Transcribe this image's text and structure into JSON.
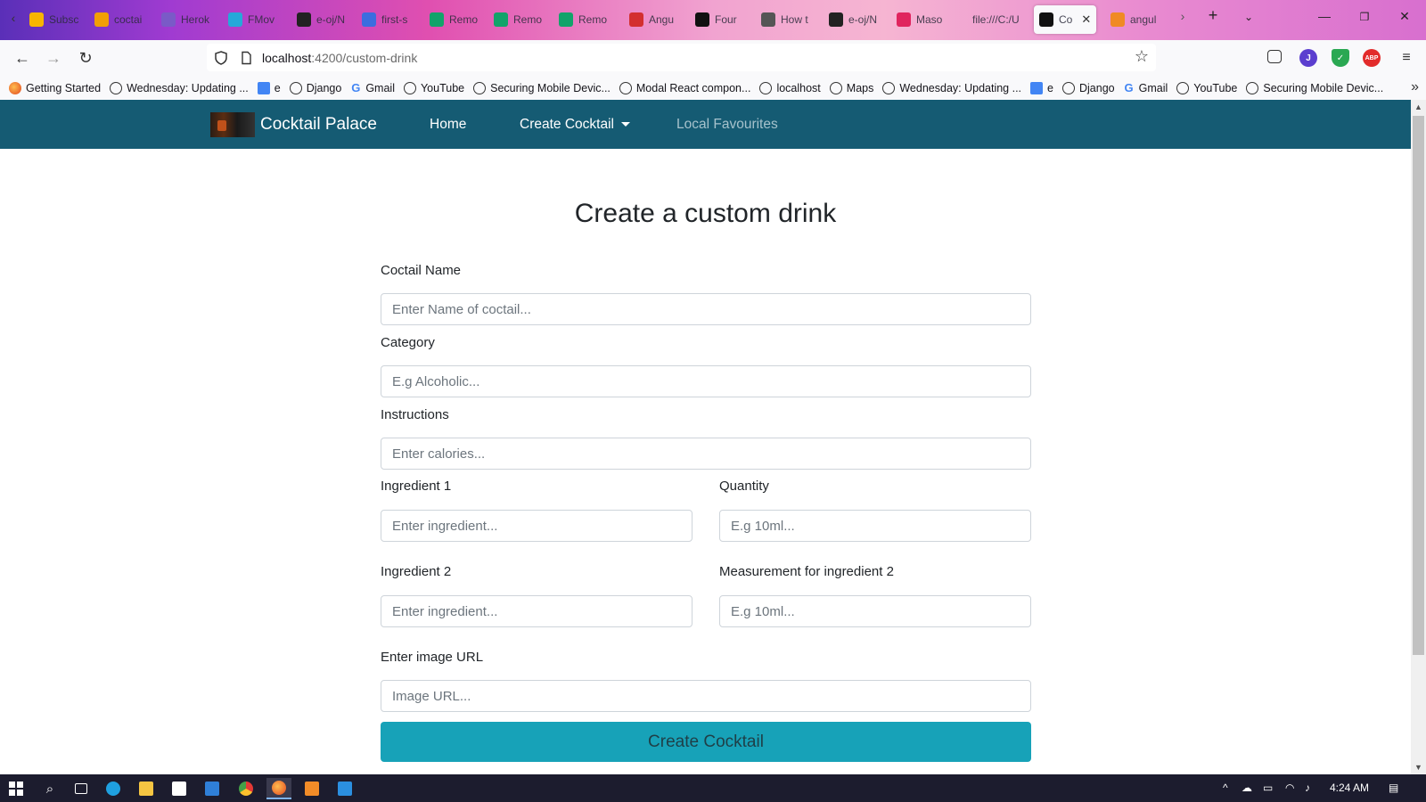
{
  "browser": {
    "tabs": [
      {
        "label": "Subsc",
        "color": "#f7b500"
      },
      {
        "label": "coctai",
        "color": "#f29f05"
      },
      {
        "label": "Herok",
        "color": "#7a5ac7"
      },
      {
        "label": "FMov",
        "color": "#25a9d9"
      },
      {
        "label": "e-oj/N",
        "color": "#222222"
      },
      {
        "label": "first-s",
        "color": "#3c6ddf"
      },
      {
        "label": "Remo",
        "color": "#12a36a"
      },
      {
        "label": "Remo",
        "color": "#12a36a"
      },
      {
        "label": "Remo",
        "color": "#12a36a"
      },
      {
        "label": "Angu",
        "color": "#d32f2f"
      },
      {
        "label": "Four",
        "color": "#111111"
      },
      {
        "label": "How t",
        "color": "#555555"
      },
      {
        "label": "e-oj/N",
        "color": "#222222"
      },
      {
        "label": "Maso",
        "color": "#e0245e"
      },
      {
        "label": "file:///C:/U",
        "color": ""
      },
      {
        "label": "Co",
        "color": "#111111"
      },
      {
        "label": "angul",
        "color": "#f08a24"
      }
    ],
    "url_host": "localhost",
    "url_path": ":4200/custom-drink",
    "bookmarks": [
      "Getting Started",
      "Wednesday: Updating ...",
      "e",
      "Django",
      "Gmail",
      "YouTube",
      "Securing Mobile Devic...",
      "Modal React compon...",
      "localhost",
      "Maps",
      "Wednesday: Updating ...",
      "e",
      "Django",
      "Gmail",
      "YouTube",
      "Securing Mobile Devic..."
    ],
    "toolbar_badges": {
      "profile": "J",
      "abp": "ABP"
    }
  },
  "app": {
    "brand": "Cocktail Palace",
    "nav": {
      "home": "Home",
      "create": "Create Cocktail",
      "favourites": "Local Favourites"
    },
    "colors": {
      "navbar": "#155b73",
      "button": "#17a2b8"
    }
  },
  "form": {
    "title": "Create a custom drink",
    "name": {
      "label": "Coctail Name",
      "placeholder": "Enter Name of coctail..."
    },
    "category": {
      "label": "Category",
      "placeholder": "E.g Alcoholic..."
    },
    "instructions": {
      "label": "Instructions",
      "placeholder": "Enter calories..."
    },
    "ingredient1": {
      "label": "Ingredient 1",
      "placeholder": "Enter ingredient..."
    },
    "quantity1": {
      "label": "Quantity",
      "placeholder": "E.g 10ml..."
    },
    "ingredient2": {
      "label": "Ingredient 2",
      "placeholder": "Enter ingredient..."
    },
    "quantity2": {
      "label": "Measurement for ingredient 2",
      "placeholder": "E.g 10ml..."
    },
    "image": {
      "label": "Enter image URL",
      "placeholder": "Image URL..."
    },
    "submit": "Create Cocktail"
  },
  "taskbar": {
    "time": "4:24 AM"
  }
}
